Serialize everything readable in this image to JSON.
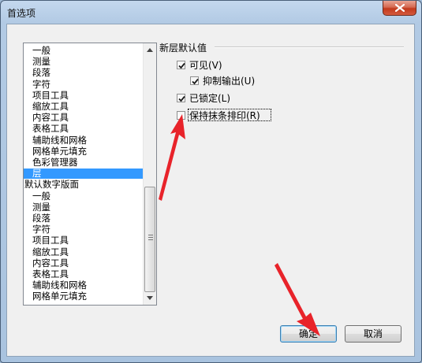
{
  "window": {
    "title": "首选项"
  },
  "categories": [
    "一般",
    "测量",
    "段落",
    "字符",
    "项目工具",
    "缩放工具",
    "内容工具",
    "表格工具",
    "辅助线和网格",
    "网格单元填充",
    "色彩管理器",
    "层",
    "默认数字版面",
    "一般",
    "测量",
    "段落",
    "字符",
    "项目工具",
    "缩放工具",
    "内容工具",
    "表格工具",
    "辅助线和网格",
    "网格单元填充"
  ],
  "selected_index": 11,
  "layer_group": {
    "title": "新层默认值",
    "options": [
      {
        "label": "可见(V)",
        "checked": true
      },
      {
        "label": "抑制输出(U)",
        "checked": true
      },
      {
        "label": "已锁定(L)",
        "checked": true
      },
      {
        "label": "保持抹条排印(R)",
        "checked": false
      }
    ]
  },
  "buttons": {
    "ok": "确定",
    "cancel": "取消"
  },
  "colors": {
    "selection": "#3399ff",
    "annotation_arrow": "#e8232a"
  }
}
